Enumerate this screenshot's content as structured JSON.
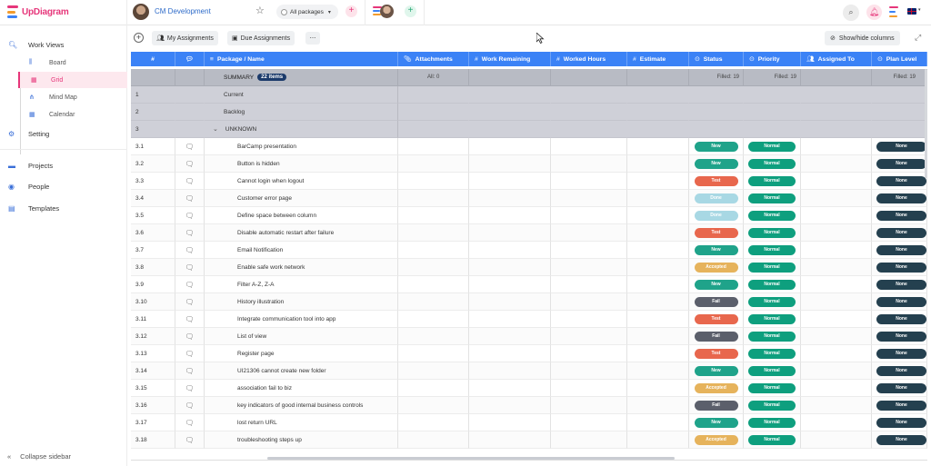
{
  "app": {
    "logo_text": "UpDiagram"
  },
  "project": {
    "name": "CM Development"
  },
  "package_select": {
    "label": "All packages"
  },
  "sidebar": {
    "work_views": "Work Views",
    "items": [
      {
        "label": "Board",
        "icon": "board-icon"
      },
      {
        "label": "Grid",
        "icon": "grid-icon"
      },
      {
        "label": "Mind Map",
        "icon": "mindmap-icon"
      },
      {
        "label": "Calendar",
        "icon": "calendar-icon"
      }
    ],
    "setting": "Setting",
    "projects": "Projects",
    "people": "People",
    "templates": "Templates",
    "collapse": "Collapse sidebar"
  },
  "toolbar": {
    "my_assignments": "My Assignments",
    "due_assignments": "Due Assignments",
    "more": "...",
    "show_hide": "Show/hide columns"
  },
  "grid": {
    "columns": {
      "num": "#",
      "name": "Package / Name",
      "attachments": "Attachments",
      "work_remaining": "Work Remaining",
      "worked_hours": "Worked Hours",
      "estimate": "Estimate",
      "status": "Status",
      "priority": "Priority",
      "assigned_to": "Assigned To",
      "plan_level": "Plan Level"
    },
    "summary": {
      "label": "SUMMARY",
      "count": "22 items",
      "attachments": "All: 0",
      "status_filled": "Filled: 19",
      "priority_filled": "Filled: 19",
      "plan_filled": "Filled: 19"
    },
    "groups": [
      {
        "num": "1",
        "name": "Current"
      },
      {
        "num": "2",
        "name": "Backlog"
      },
      {
        "num": "3",
        "name": "UNKNOWN"
      }
    ],
    "rows": [
      {
        "num": "3.1",
        "name": "BarCamp presentation",
        "status": "New",
        "priority": "Normal",
        "plan": "None"
      },
      {
        "num": "3.2",
        "name": "Button is hidden",
        "status": "New",
        "priority": "Normal",
        "plan": "None"
      },
      {
        "num": "3.3",
        "name": "Cannot login when logout",
        "status": "Test",
        "priority": "Normal",
        "plan": "None"
      },
      {
        "num": "3.4",
        "name": "Customer error page",
        "status": "Done",
        "priority": "Normal",
        "plan": "None"
      },
      {
        "num": "3.5",
        "name": "Define space between column",
        "status": "Done",
        "priority": "Normal",
        "plan": "None"
      },
      {
        "num": "3.6",
        "name": "Disable automatic restart after failure",
        "status": "Test",
        "priority": "Normal",
        "plan": "None"
      },
      {
        "num": "3.7",
        "name": "Email Notification",
        "status": "New",
        "priority": "Normal",
        "plan": "None"
      },
      {
        "num": "3.8",
        "name": "Enable safe work network",
        "status": "Accepted",
        "priority": "Normal",
        "plan": "None"
      },
      {
        "num": "3.9",
        "name": "Filter A-Z, Z-A",
        "status": "New",
        "priority": "Normal",
        "plan": "None"
      },
      {
        "num": "3.10",
        "name": "History illustration",
        "status": "Fail",
        "priority": "Normal",
        "plan": "None"
      },
      {
        "num": "3.11",
        "name": "Integrate communication tool into app",
        "status": "Test",
        "priority": "Normal",
        "plan": "None"
      },
      {
        "num": "3.12",
        "name": "List of view",
        "status": "Fail",
        "priority": "Normal",
        "plan": "None"
      },
      {
        "num": "3.13",
        "name": "Register page",
        "status": "Test",
        "priority": "Normal",
        "plan": "None"
      },
      {
        "num": "3.14",
        "name": "UI21306 cannot create new folder",
        "status": "New",
        "priority": "Normal",
        "plan": "None"
      },
      {
        "num": "3.15",
        "name": "association fail to biz",
        "status": "Accepted",
        "priority": "Normal",
        "plan": "None"
      },
      {
        "num": "3.16",
        "name": "key indicators of good internal business controls",
        "status": "Fail",
        "priority": "Normal",
        "plan": "None"
      },
      {
        "num": "3.17",
        "name": "lost return URL",
        "status": "New",
        "priority": "Normal",
        "plan": "None"
      },
      {
        "num": "3.18",
        "name": "troubleshooting steps up",
        "status": "Accepted",
        "priority": "Normal",
        "plan": "None"
      }
    ]
  },
  "colors": {
    "brand": "#e6367a",
    "header": "#3b82f6",
    "status": {
      "New": "#1fa38a",
      "Test": "#e8674d",
      "Done": "#a8d8e4",
      "Accepted": "#e6b35c",
      "Fail": "#5b5f6b"
    },
    "priority_normal": "#0e9f7e",
    "plan_none": "#24404f"
  }
}
